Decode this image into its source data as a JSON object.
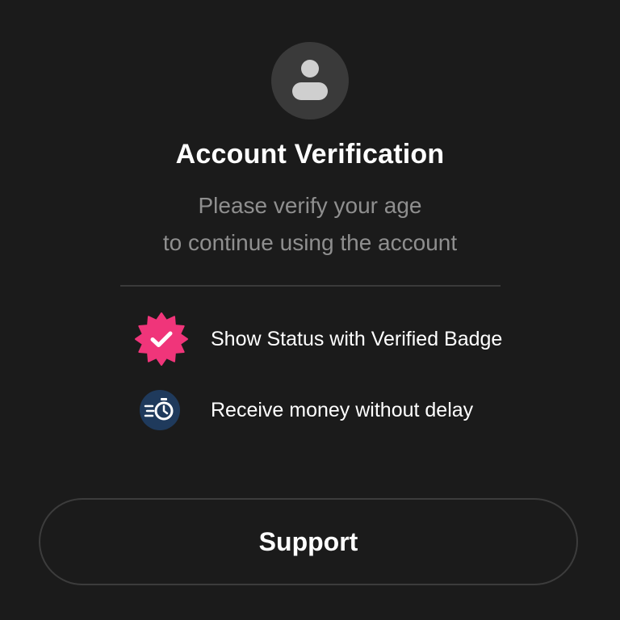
{
  "header": {
    "avatar_icon": "user-silhouette-icon",
    "title": "Account Verification",
    "subtitle_line1": "Please verify your age",
    "subtitle_line2": "to continue using the account"
  },
  "features": [
    {
      "icon": "verified-badge-icon",
      "label": "Show Status with Verified Badge"
    },
    {
      "icon": "fast-timer-icon",
      "label": "Receive money without delay"
    }
  ],
  "actions": {
    "support_label": "Support"
  },
  "colors": {
    "background": "#1b1b1b",
    "avatar_bg": "#3a3a3a",
    "badge": "#f0357a",
    "timer_bg": "#1f3a5c",
    "subtitle": "#8f8f8f",
    "divider": "#3a3a3a"
  }
}
